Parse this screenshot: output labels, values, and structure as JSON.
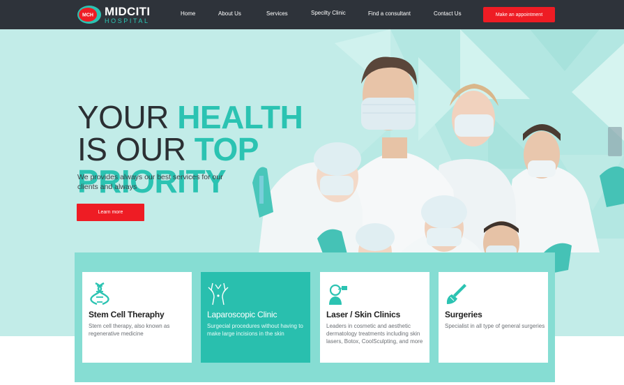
{
  "brand": {
    "badge": "MCH",
    "name": "MIDCITI",
    "sub": "HOSPITAL"
  },
  "nav": {
    "items": [
      "Home",
      "About Us",
      "Services",
      "Specilty Clinic",
      "Find a consultant",
      "Contact Us"
    ],
    "cta": "Make an appointment"
  },
  "hero": {
    "line1_dark": "YOUR",
    "line1_teal": "HEALTH",
    "line2_dark": "IS OUR",
    "line2_teal": "TOP",
    "line3_teal": "PRIORITY",
    "tagline": "We provides always our best services for our clients and  always",
    "button": "Learn more"
  },
  "services": [
    {
      "title": "Stem Cell Theraphy",
      "desc": "Stem cell therapy, also known as regenerative medicine",
      "icon": "dna-icon",
      "active": false
    },
    {
      "title": "Laparoscopic Clinic",
      "desc": "Surgecial procedures without having to make large incisions in the skin",
      "icon": "body-icon",
      "active": true
    },
    {
      "title": "Laser / Skin Clinics",
      "desc": "Leaders in cosmetic and aesthetic dermatology treatments including skin lasers, Botox, CoolSculpting, and more",
      "icon": "laser-face-icon",
      "active": false
    },
    {
      "title": "Surgeries",
      "desc": "Specialist in all type of general surgeries",
      "icon": "scalpel-hand-icon",
      "active": false
    }
  ],
  "colors": {
    "nav_bg": "#2e333a",
    "accent_teal": "#2bc3b2",
    "cta_red": "#ee1c24",
    "hero_bg": "#c2ece8",
    "panel_bg": "#86ddd3"
  }
}
